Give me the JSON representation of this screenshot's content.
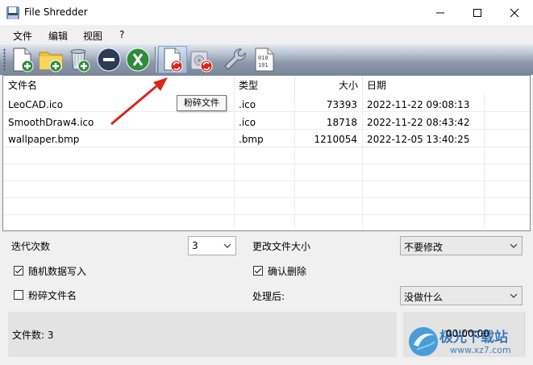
{
  "window": {
    "title": "File Shredder"
  },
  "menu": [
    "文件",
    "编辑",
    "视图",
    "?"
  ],
  "toolbar": {
    "tooltip": "粉碎文件",
    "colors": {
      "accent": "#1c6fd4",
      "green": "#2e8b3a",
      "red": "#d7261e",
      "navy": "#2b3c57"
    },
    "buttons": [
      {
        "name": "add-file-icon"
      },
      {
        "name": "add-folder-icon"
      },
      {
        "name": "add-recycle-bin-icon"
      },
      {
        "name": "remove-item-icon"
      },
      {
        "name": "clear-list-icon"
      },
      {
        "name": "shred-files-icon"
      },
      {
        "name": "shred-free-space-icon"
      },
      {
        "name": "settings-wrench-icon"
      },
      {
        "name": "binary-file-icon"
      }
    ]
  },
  "list": {
    "headers": {
      "name": "文件名",
      "type": "类型",
      "size": "大小",
      "date": "日期"
    },
    "rows": [
      {
        "name": "LeoCAD.ico",
        "type": ".ico",
        "size": "73393",
        "date": "2022-11-22 09:08:13"
      },
      {
        "name": "SmoothDraw4.ico",
        "type": ".ico",
        "size": "18718",
        "date": "2022-11-22 08:43:42"
      },
      {
        "name": "wallpaper.bmp",
        "type": ".bmp",
        "size": "1210054",
        "date": "2022-12-05 13:40:25"
      }
    ]
  },
  "options": {
    "iterations_label": "迭代次数",
    "iterations_value": "3",
    "change_size_label": "更改文件大小",
    "change_size_value": "不要修改",
    "random_data": {
      "label": "随机数据写入",
      "checked": true
    },
    "confirm_delete": {
      "label": "确认删除",
      "checked": true
    },
    "shred_names": {
      "label": "粉碎文件名",
      "checked": false
    },
    "after_label": "处理后:",
    "after_value": "没做什么"
  },
  "status": {
    "file_count": "文件数: 3",
    "elapsed": "00:00:00"
  },
  "watermark": {
    "brand": "极光下载站",
    "url": "www.xz7.com"
  }
}
